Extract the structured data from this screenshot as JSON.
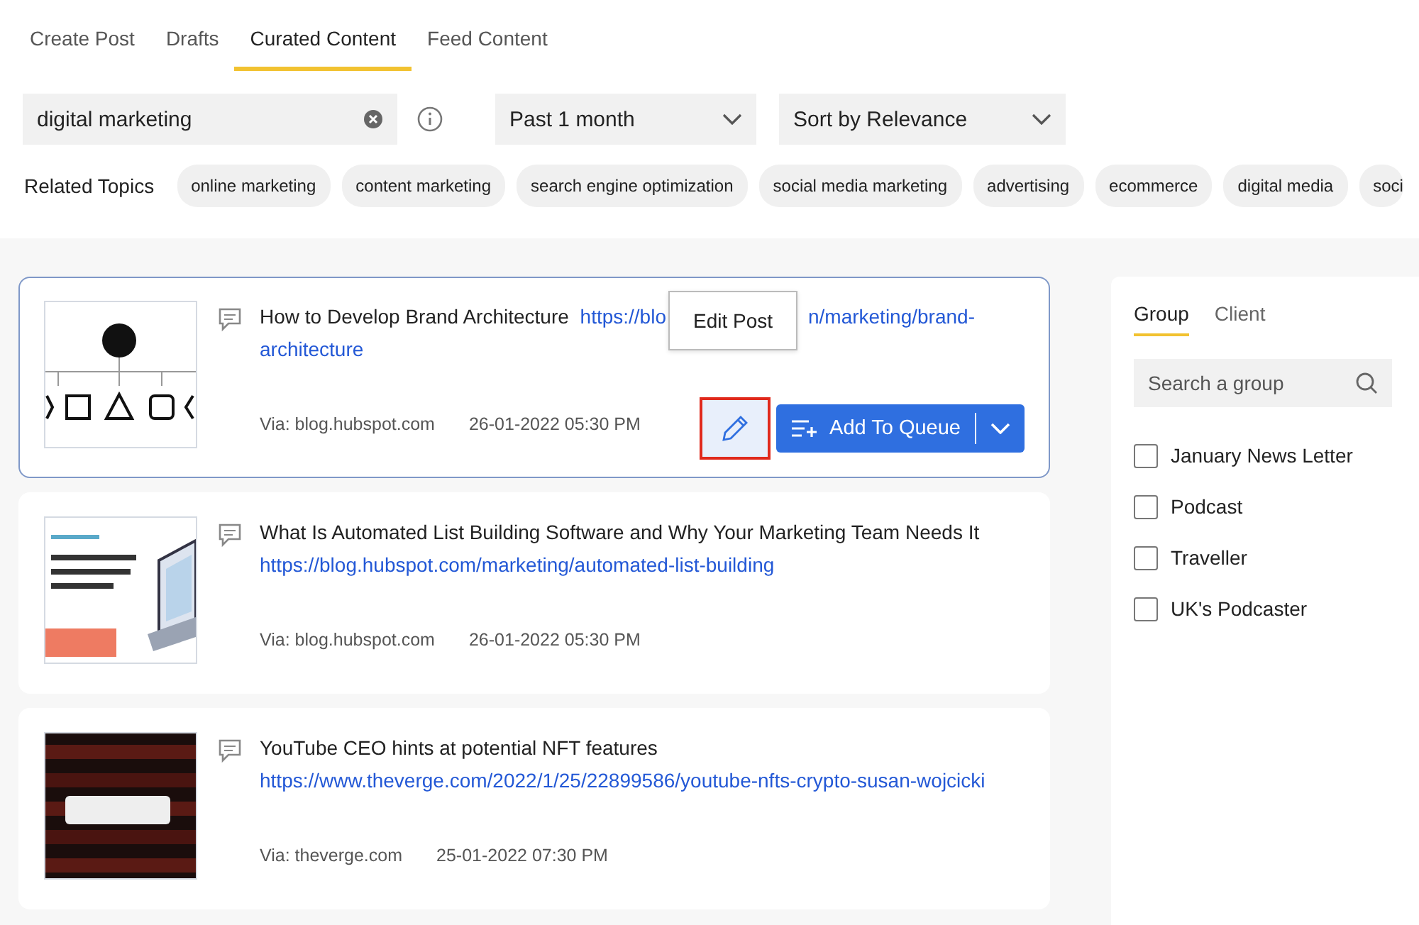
{
  "tabs": [
    {
      "label": "Create Post",
      "selected": false
    },
    {
      "label": "Drafts",
      "selected": false
    },
    {
      "label": "Curated Content",
      "selected": true
    },
    {
      "label": "Feed Content",
      "selected": false
    }
  ],
  "search": {
    "value": "digital marketing"
  },
  "filters": [
    {
      "value": "Past 1 month"
    },
    {
      "value": "Sort by Relevance"
    }
  ],
  "related_topics": {
    "label": "Related Topics",
    "topics": [
      "online marketing",
      "content marketing",
      "search engine optimization",
      "social media marketing",
      "advertising",
      "ecommerce",
      "digital media",
      "soci"
    ]
  },
  "posts": [
    {
      "selected": true,
      "title": "How to Develop Brand Architecture",
      "link_parts": [
        "https://blo",
        "n/marketing/brand-",
        "architecture"
      ],
      "via": "Via: blog.hubspot.com",
      "date": "26-01-2022 05:30 PM",
      "tooltip": "Edit Post",
      "edit_highlighted": true,
      "queue_button": "Add To Queue"
    },
    {
      "selected": false,
      "title": "What Is Automated List Building Software and Why Your Marketing Team Needs It",
      "link_parts": [
        "https://blog.hubspot.com/marketing/automated-list-building"
      ],
      "via": "Via: blog.hubspot.com",
      "date": "26-01-2022 05:30 PM"
    },
    {
      "selected": false,
      "title": "YouTube CEO hints at potential NFT features",
      "link_parts": [
        "https://www.theverge.com/2022/1/25/22899586/youtube-nfts-crypto-susan-wojcicki"
      ],
      "via": "Via: theverge.com",
      "date": "25-01-2022 07:30 PM"
    }
  ],
  "side_panel": {
    "tabs": [
      {
        "label": "Group",
        "selected": true
      },
      {
        "label": "Client",
        "selected": false
      }
    ],
    "search": {
      "placeholder": "Search a group"
    },
    "groups": [
      {
        "label": "January News Letter",
        "checked": false
      },
      {
        "label": "Podcast",
        "checked": false
      },
      {
        "label": "Traveller",
        "checked": false
      },
      {
        "label": "UK's Podcaster",
        "checked": false
      }
    ]
  }
}
